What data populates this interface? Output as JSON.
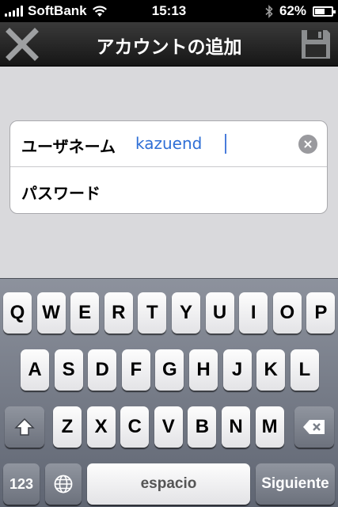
{
  "status_bar": {
    "carrier": "SoftBank",
    "time": "15:13",
    "battery_text": "62%",
    "battery_level": 0.62
  },
  "nav": {
    "title": "アカウントの追加",
    "close_icon": "close-x-icon",
    "save_icon": "floppy-save-icon"
  },
  "form": {
    "username_label": "ユーザネーム",
    "username_value": "kazuend",
    "password_label": "パスワード"
  },
  "keyboard": {
    "row1": [
      "Q",
      "W",
      "E",
      "R",
      "T",
      "Y",
      "U",
      "I",
      "O",
      "P"
    ],
    "row2": [
      "A",
      "S",
      "D",
      "F",
      "G",
      "H",
      "J",
      "K",
      "L"
    ],
    "row3": [
      "Z",
      "X",
      "C",
      "V",
      "B",
      "N",
      "M"
    ],
    "numbers_label": "123",
    "space_label": "espacio",
    "next_label": "Siguiente",
    "shift_icon": "shift-icon",
    "delete_icon": "backspace-icon",
    "globe_icon": "globe-icon"
  }
}
